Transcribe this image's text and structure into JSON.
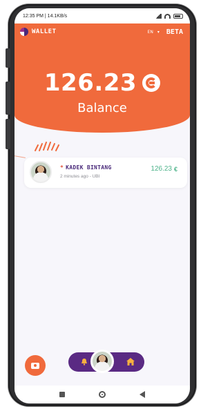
{
  "status_bar": {
    "time_speed": "12:35 PM | 14.1KB/s"
  },
  "header": {
    "app_title": "WALLET",
    "language": "EN",
    "beta_label": "BETA",
    "balance_amount": "126.23",
    "balance_label": "Balance"
  },
  "transactions": [
    {
      "name": "KADEK BINTANG",
      "meta": "2 minutes ago - UBI",
      "amount": "126.23"
    }
  ],
  "colors": {
    "accent": "#f06a3c",
    "purple": "#5a2a83",
    "positive_amount": "#4db38a"
  },
  "icons": {
    "fab": "camera-icon",
    "nav_left": "bell-icon",
    "nav_right": "home-icon",
    "currency": "coin-icon"
  }
}
